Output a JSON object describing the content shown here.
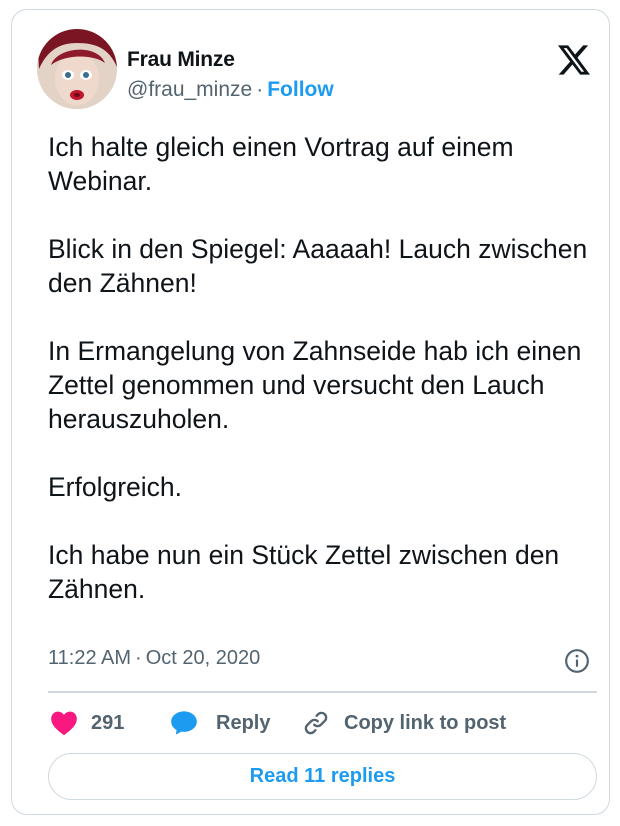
{
  "author": {
    "name": "Frau Minze",
    "handle": "@frau_minze",
    "separator": "·",
    "follow_label": "Follow"
  },
  "tweet": {
    "text": "Ich halte gleich einen Vortrag auf einem Webinar.\n\nBlick in den Spiegel: Aaaaah! Lauch zwischen den Zähnen!\n\nIn Ermangelung von Zahnseide hab ich einen Zettel genommen und versucht den Lauch herauszuholen.\n\nErfolgreich.\n\nIch habe nun ein Stück Zettel zwischen den Zähnen.",
    "time": "11:22 AM",
    "date": "Oct 20, 2020"
  },
  "actions": {
    "like_count": "291",
    "reply_label": "Reply",
    "copy_label": "Copy link to post"
  },
  "read_replies_label": "Read 11 replies",
  "icons": {
    "logo": "x-logo-icon",
    "info": "info-icon",
    "like": "heart-icon",
    "reply": "speech-bubble-icon",
    "copy": "link-icon"
  },
  "colors": {
    "accent": "#1d9bf0",
    "like": "#f91880",
    "text": "#0f1419",
    "muted": "#536471",
    "border": "#cfd9de"
  }
}
